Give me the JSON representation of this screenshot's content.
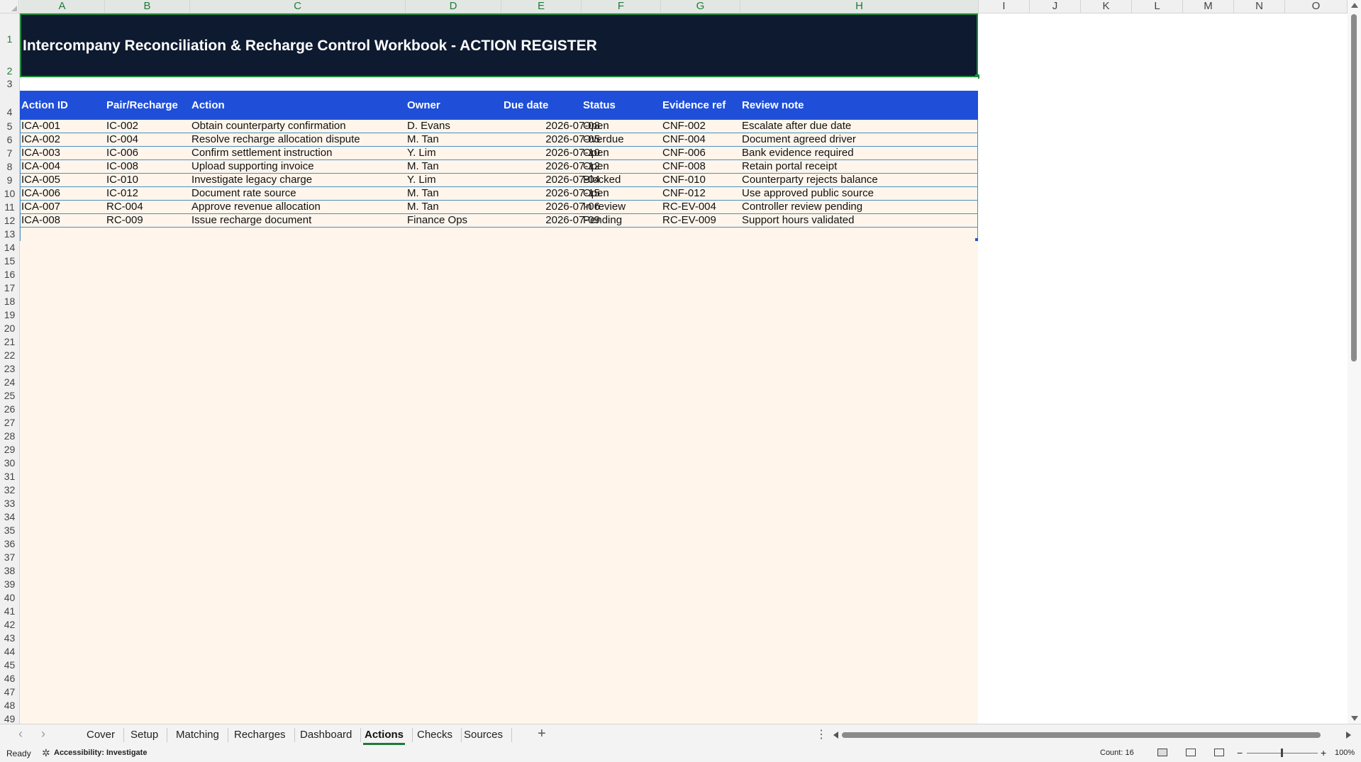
{
  "columns": [
    "A",
    "B",
    "C",
    "D",
    "E",
    "F",
    "G",
    "H",
    "I",
    "J",
    "K",
    "L",
    "M",
    "N",
    "O"
  ],
  "rows": [
    "1",
    "2",
    "3",
    "4",
    "5",
    "6",
    "7",
    "8",
    "9",
    "10",
    "11",
    "12",
    "13",
    "14",
    "15",
    "16",
    "17",
    "18",
    "19",
    "20",
    "21",
    "22",
    "23",
    "24",
    "25",
    "26",
    "27",
    "28",
    "29",
    "30",
    "31",
    "32",
    "33",
    "34",
    "35",
    "36",
    "37",
    "38",
    "39",
    "40",
    "41",
    "42",
    "43",
    "44",
    "45",
    "46",
    "47",
    "48",
    "49"
  ],
  "sheet": {
    "title": "Intercompany Reconciliation & Recharge Control Workbook - ACTION REGISTER",
    "headers": [
      "Action ID",
      "Pair/Recharge",
      "Action",
      "Owner",
      "Due date",
      "Status",
      "Evidence ref",
      "Review note"
    ],
    "data": [
      [
        "ICA-001",
        "IC-002",
        "Obtain counterparty confirmation",
        "D. Evans",
        "2026-07-08",
        "Open",
        "CNF-002",
        "Escalate after due date"
      ],
      [
        "ICA-002",
        "IC-004",
        "Resolve recharge allocation dispute",
        "M. Tan",
        "2026-07-05",
        "Overdue",
        "CNF-004",
        "Document agreed driver"
      ],
      [
        "ICA-003",
        "IC-006",
        "Confirm settlement instruction",
        "Y. Lim",
        "2026-07-10",
        "Open",
        "CNF-006",
        "Bank evidence required"
      ],
      [
        "ICA-004",
        "IC-008",
        "Upload supporting invoice",
        "M. Tan",
        "2026-07-12",
        "Open",
        "CNF-008",
        "Retain portal receipt"
      ],
      [
        "ICA-005",
        "IC-010",
        "Investigate legacy charge",
        "Y. Lim",
        "2026-07-04",
        "Blocked",
        "CNF-010",
        "Counterparty rejects balance"
      ],
      [
        "ICA-006",
        "IC-012",
        "Document rate source",
        "M. Tan",
        "2026-07-15",
        "Open",
        "CNF-012",
        "Use approved public source"
      ],
      [
        "ICA-007",
        "RC-004",
        "Approve revenue allocation",
        "M. Tan",
        "2026-07-06",
        "In review",
        "RC-EV-004",
        "Controller review pending"
      ],
      [
        "ICA-008",
        "RC-009",
        "Issue recharge document",
        "Finance Ops",
        "2026-07-09",
        "Pending",
        "RC-EV-009",
        "Support hours validated"
      ]
    ]
  },
  "tabs": {
    "items": [
      "Cover",
      "Setup",
      "Matching",
      "Recharges",
      "Dashboard",
      "Actions",
      "Checks",
      "Sources"
    ],
    "active": "Actions",
    "prev": "‹",
    "next": "›",
    "add": "+",
    "more": "⋮"
  },
  "status": {
    "ready": "Ready",
    "accessibility": "Accessibility: Investigate",
    "count": "Count: 16",
    "zoom": "100%",
    "zoom_minus": "−",
    "zoom_plus": "+"
  },
  "colors": {
    "title_bg": "#0d1a2f",
    "header_bg": "#1f4fd9",
    "sheet_bg": "#fff5eb",
    "accent": "#1f7a3a"
  },
  "icons": {
    "accessibility": "accessibility-icon",
    "normal_view": "normal-view-icon",
    "page_layout": "page-layout-icon",
    "page_break": "page-break-icon"
  }
}
